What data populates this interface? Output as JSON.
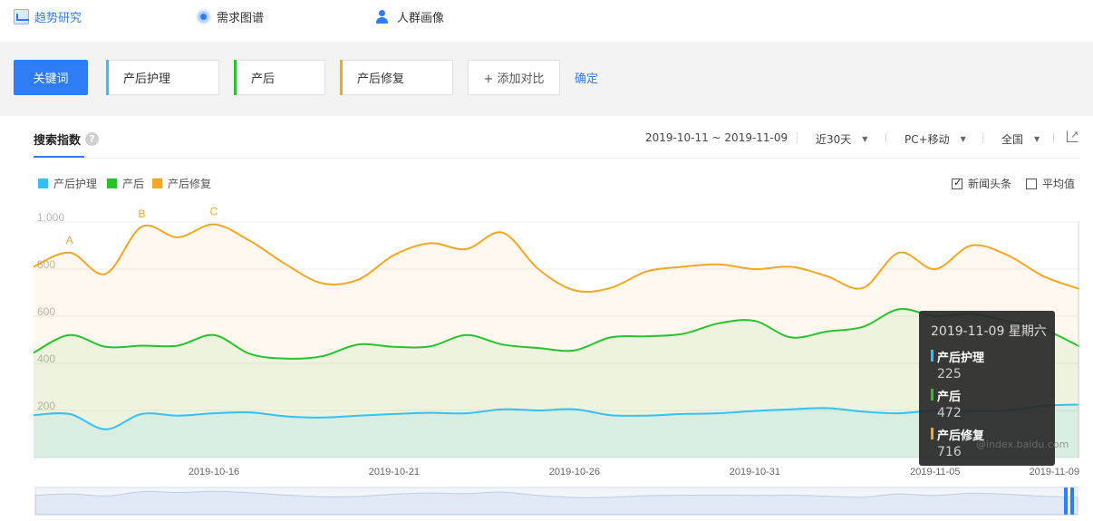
{
  "nav": {
    "trend": "趋势研究",
    "demand": "需求图谱",
    "crowd": "人群画像"
  },
  "compare": {
    "keyword_label": "关键词",
    "keywords": [
      {
        "label": "产后护理",
        "color": "#34c0f5"
      },
      {
        "label": "产后",
        "color": "#27c22c"
      },
      {
        "label": "产后修复",
        "color": "#f5a623"
      }
    ],
    "add_label": "+ 添加对比",
    "confirm_label": "确定"
  },
  "panel": {
    "tab_title": "搜索指数",
    "help_glyph": "?",
    "date_range": "2019-10-11 ~ 2019-11-09",
    "period": "近30天",
    "device": "PC+移动",
    "region": "全国",
    "news_label": "新闻头条",
    "news_checked": true,
    "avg_label": "平均值",
    "avg_checked": false
  },
  "chart_data": {
    "type": "area",
    "yticks": [
      "1,000",
      "800",
      "600",
      "400",
      "200"
    ],
    "ylim": [
      0,
      1000
    ],
    "x_tick_labels": [
      "2019-10-16",
      "2019-10-21",
      "2019-10-26",
      "2019-10-31",
      "2019-11-05",
      "2019-11-09"
    ],
    "x": [
      "2019-10-11",
      "2019-10-12",
      "2019-10-13",
      "2019-10-14",
      "2019-10-15",
      "2019-10-16",
      "2019-10-17",
      "2019-10-18",
      "2019-10-19",
      "2019-10-20",
      "2019-10-21",
      "2019-10-22",
      "2019-10-23",
      "2019-10-24",
      "2019-10-25",
      "2019-10-26",
      "2019-10-27",
      "2019-10-28",
      "2019-10-29",
      "2019-10-30",
      "2019-10-31",
      "2019-11-01",
      "2019-11-02",
      "2019-11-03",
      "2019-11-04",
      "2019-11-05",
      "2019-11-06",
      "2019-11-07",
      "2019-11-08",
      "2019-11-09"
    ],
    "series": [
      {
        "name": "产后护理",
        "color": "#34c0f5",
        "values": [
          180,
          185,
          120,
          185,
          178,
          188,
          192,
          175,
          170,
          178,
          185,
          190,
          188,
          205,
          200,
          205,
          180,
          178,
          185,
          188,
          198,
          205,
          210,
          195,
          188,
          200,
          198,
          200,
          220,
          225
        ]
      },
      {
        "name": "产后",
        "color": "#27c22c",
        "values": [
          445,
          520,
          470,
          475,
          475,
          520,
          440,
          420,
          430,
          480,
          470,
          472,
          520,
          480,
          465,
          455,
          510,
          515,
          525,
          570,
          580,
          510,
          535,
          555,
          630,
          600,
          610,
          580,
          545,
          472
        ]
      },
      {
        "name": "产后修复",
        "color": "#f5a623",
        "values": [
          810,
          870,
          780,
          980,
          935,
          990,
          920,
          820,
          740,
          755,
          860,
          910,
          885,
          955,
          800,
          710,
          720,
          790,
          810,
          820,
          800,
          810,
          770,
          720,
          870,
          800,
          900,
          860,
          770,
          716
        ]
      }
    ],
    "annotations": [
      {
        "label": "A",
        "x": "2019-10-12"
      },
      {
        "label": "B",
        "x": "2019-10-14"
      },
      {
        "label": "C",
        "x": "2019-10-16"
      }
    ],
    "legend": "top-left",
    "grid": true
  },
  "tooltip": {
    "date": "2019-11-09 星期六",
    "rows": [
      {
        "name": "产后护理",
        "value": "225",
        "color": "#34c0f5"
      },
      {
        "name": "产后",
        "value": "472",
        "color": "#27c22c"
      },
      {
        "name": "产后修复",
        "value": "716",
        "color": "#f5a623"
      }
    ]
  },
  "watermark": "@index.baidu.com"
}
